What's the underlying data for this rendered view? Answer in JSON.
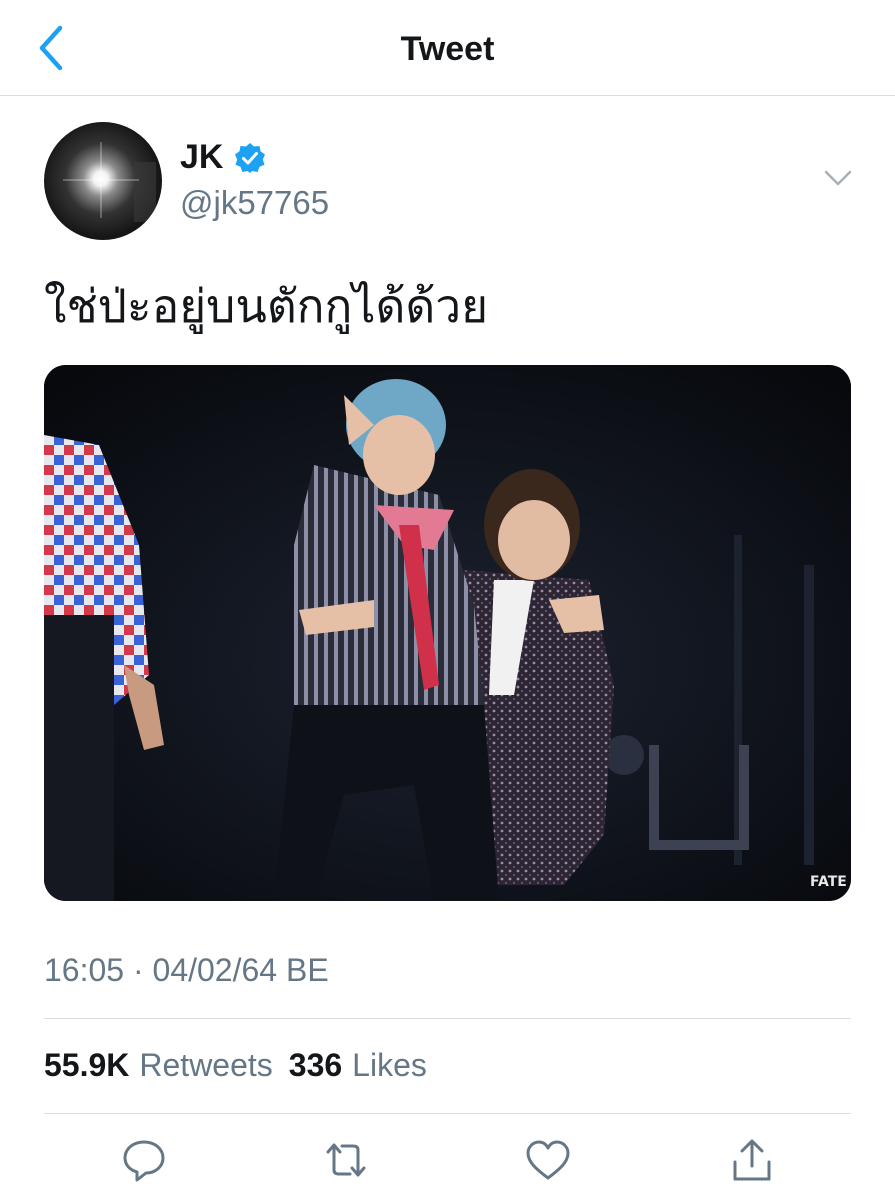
{
  "nav": {
    "title": "Tweet",
    "back_icon": "chevron-left-icon"
  },
  "author": {
    "display_name": "JK",
    "handle": "@jk57765",
    "verified": true
  },
  "tweet": {
    "text": "ใช่ป่ะอยู่บนตักกูได้ด้วย",
    "media_watermark": "FATE",
    "timestamp": "16:05 · 04/02/64 BE"
  },
  "stats": {
    "retweets_count": "55.9K",
    "retweets_label": "Retweets",
    "likes_count": "336",
    "likes_label": "Likes"
  },
  "actions": [
    "reply-icon",
    "retweet-icon",
    "like-icon",
    "share-icon"
  ],
  "colors": {
    "accent": "#1da1f2",
    "text": "#14171a",
    "muted": "#657786",
    "divider": "#dcdfe2"
  }
}
